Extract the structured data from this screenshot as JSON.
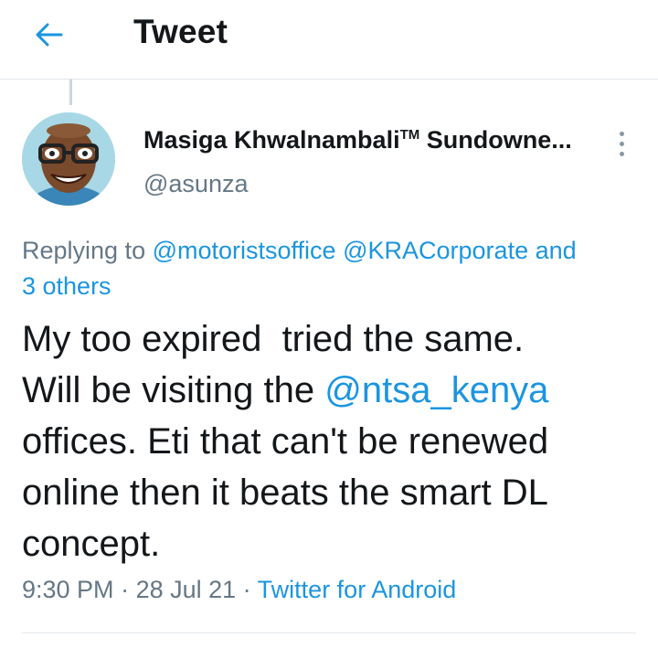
{
  "header": {
    "title": "Tweet",
    "back_icon": "arrow-left-icon",
    "accent_color": "#1b95e0"
  },
  "tweet": {
    "author": {
      "name": "Masiga Khwalnambali",
      "tm": "TM",
      "name_suffix": " Sundowne...",
      "handle": "@asunza",
      "avatar_icon": "cartoon-avatar"
    },
    "more_icon": "more-vertical-icon",
    "replying": {
      "prefix": "Replying to ",
      "mention1": "@motoristsoffice",
      "mention2": "@KRACorporate",
      "and_text": " and",
      "others": "3 others"
    },
    "text": {
      "part1": "My too expired  tried the same.\nWill be visiting the ",
      "mention": "@ntsa_kenya",
      "part2": "\noffices. Eti that can't be renewed online then it beats the smart DL concept."
    },
    "meta": {
      "time": "9:30 PM",
      "separator": " · ",
      "date": "28 Jul 21",
      "source": "Twitter for Android"
    }
  }
}
